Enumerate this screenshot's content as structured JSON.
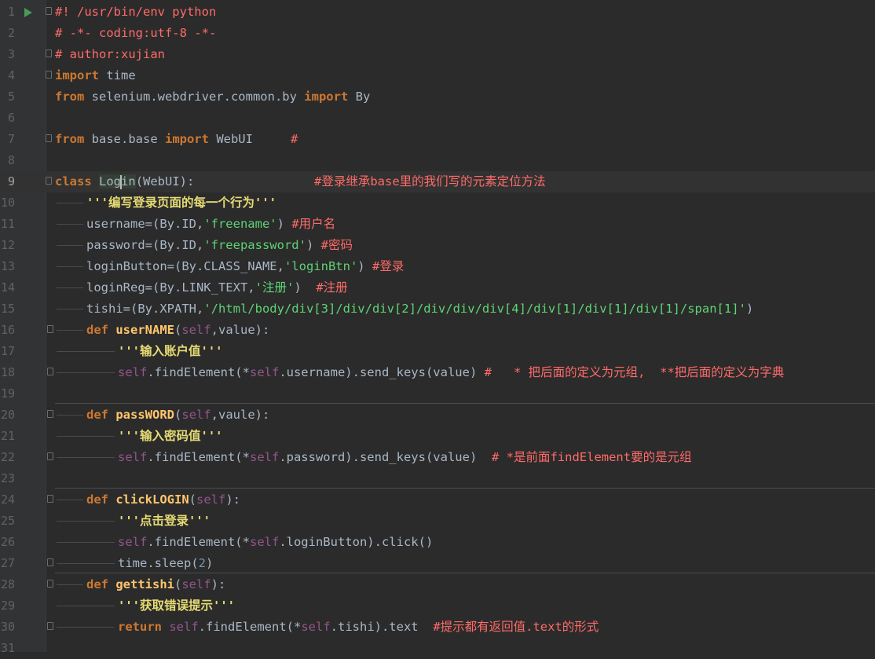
{
  "editor": {
    "current_line": 9,
    "lines": [
      {
        "n": "1",
        "text": "#! /usr/bin/env python"
      },
      {
        "n": "2",
        "text": "# -*- coding:utf-8 -*-"
      },
      {
        "n": "3",
        "text": "# author:xujian"
      },
      {
        "n": "4",
        "kw": "import",
        "rest": " time"
      },
      {
        "n": "5",
        "kw1": "from",
        "mid": " selenium.webdriver.common.by ",
        "kw2": "import",
        "rest": " By"
      },
      {
        "n": "6"
      },
      {
        "n": "7",
        "kw1": "from",
        "mid": " base.base ",
        "kw2": "import",
        "rest": " WebUI",
        "comment": "#"
      },
      {
        "n": "8"
      },
      {
        "n": "9",
        "kw": "class",
        "name_a": "Log",
        "name_b": "in",
        "rest": "(WebUI):",
        "comment": "#登录继承base里的我们写的元素定位方法"
      },
      {
        "n": "10",
        "doc": "'''编写登录页面的每一个行为'''"
      },
      {
        "n": "11",
        "prefix": "username=(By.ID,",
        "str": "'freename'",
        "suffix": ")",
        "comment": "#用户名"
      },
      {
        "n": "12",
        "prefix": "password=(By.ID,",
        "str": "'freepassword'",
        "suffix": ")",
        "comment": "#密码"
      },
      {
        "n": "13",
        "prefix": "loginButton=(By.CLASS_NAME,",
        "str": "'loginBtn'",
        "suffix": ")",
        "comment": "#登录"
      },
      {
        "n": "14",
        "prefix": "loginReg=(By.LINK_TEXT,",
        "str": "'注册'",
        "suffix": ")",
        "comment": "#注册"
      },
      {
        "n": "15",
        "prefix": "tishi=(By.XPATH,",
        "str": "'/html/body/div[3]/div/div[2]/div/div/div[4]/div[1]/div[1]/div[1]/span[1]'",
        "suffix": ")"
      },
      {
        "n": "16",
        "kw": "def",
        "fn": "userNAME",
        "args_a": "(",
        "self": "self",
        "args_b": ",value):"
      },
      {
        "n": "17",
        "doc": "'''输入账户值'''"
      },
      {
        "n": "18",
        "self1": "self",
        "mid": ".findElement(*",
        "self2": "self",
        "rest": ".username).send_keys(value)",
        "comment": "#   * 把后面的定义为元组,  **把后面的定义为字典"
      },
      {
        "n": "19"
      },
      {
        "n": "20",
        "kw": "def",
        "fn": "passWORD",
        "args_a": "(",
        "self": "self",
        "args_b": ",vaule):"
      },
      {
        "n": "21",
        "doc": "'''输入密码值'''"
      },
      {
        "n": "22",
        "self1": "self",
        "mid": ".findElement(*",
        "self2": "self",
        "rest": ".password).send_keys(value)",
        "comment": "# *是前面findElement要的是元组"
      },
      {
        "n": "23"
      },
      {
        "n": "24",
        "kw": "def",
        "fn": "clickLOGIN",
        "args_a": "(",
        "self": "self",
        "args_b": "):"
      },
      {
        "n": "25",
        "doc": "'''点击登录'''"
      },
      {
        "n": "26",
        "self1": "self",
        "mid": ".findElement(*",
        "self2": "self",
        "rest": ".loginButton).click()"
      },
      {
        "n": "27",
        "prefix": "time.sleep(",
        "num": "2",
        "suffix": ")"
      },
      {
        "n": "28",
        "kw": "def",
        "fn": "gettishi",
        "args_a": "(",
        "self": "self",
        "args_b": "):"
      },
      {
        "n": "29",
        "doc": "'''获取错误提示'''"
      },
      {
        "n": "30",
        "kw": "return",
        "self1": "self",
        "mid": ".findElement(*",
        "self2": "self",
        "rest": ".tishi).text",
        "comment": "#提示都有返回值.text的形式"
      },
      {
        "n": "31"
      }
    ]
  }
}
